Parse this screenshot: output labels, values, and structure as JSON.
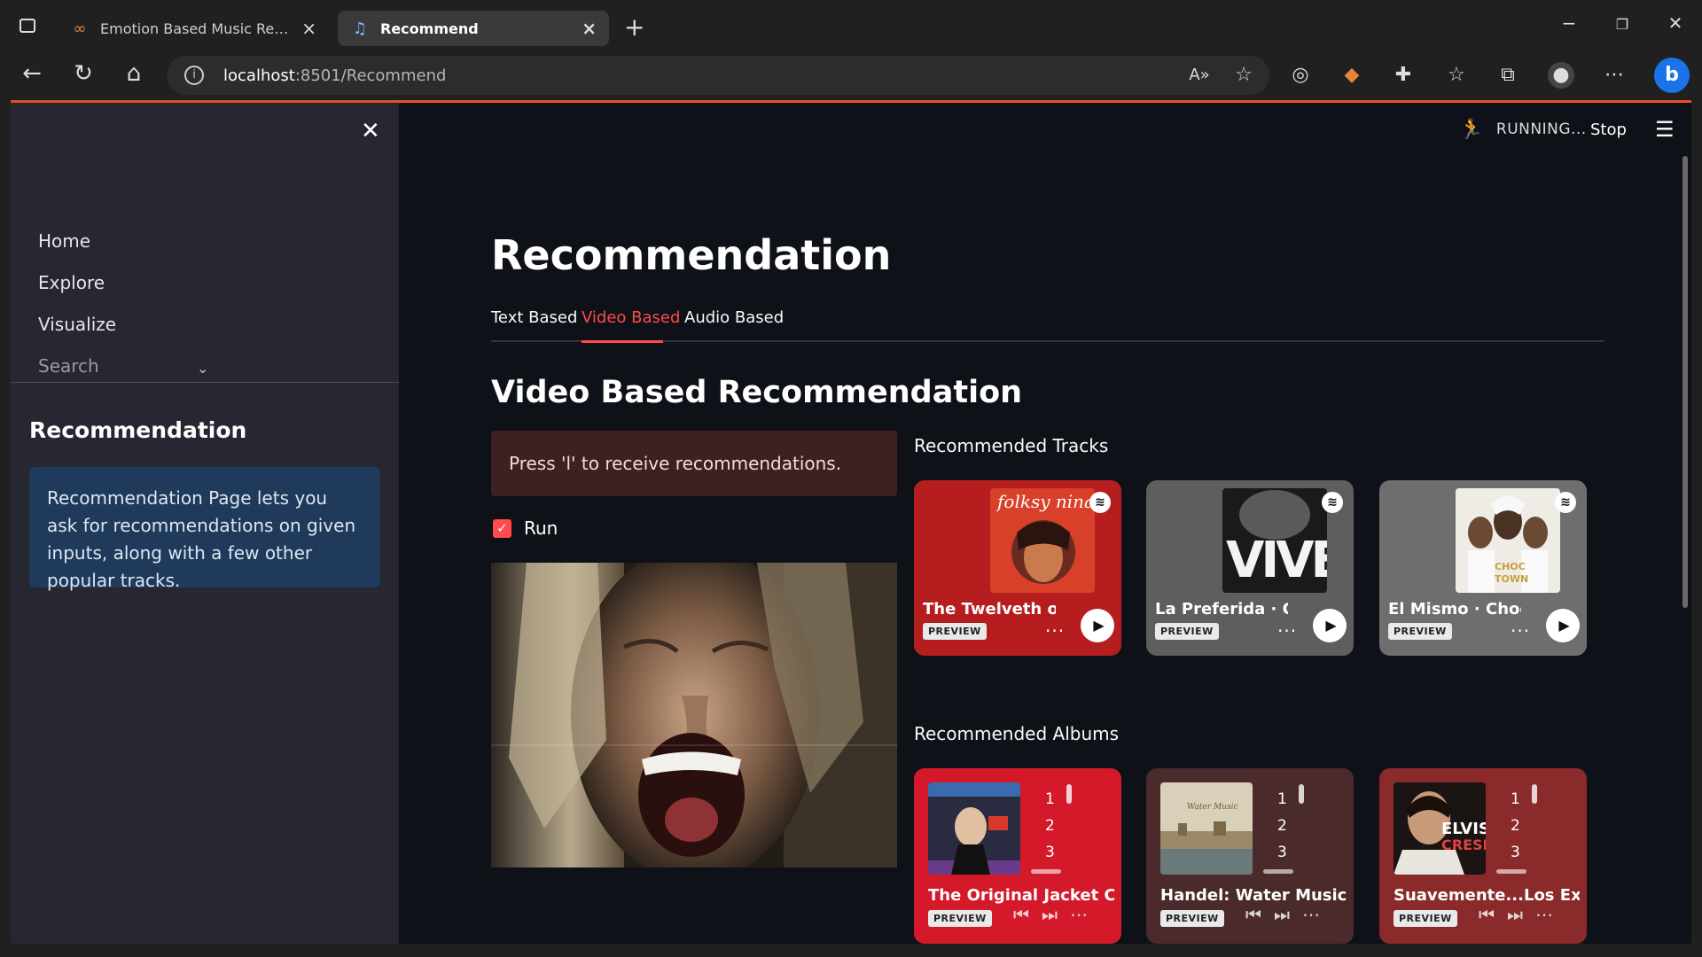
{
  "browser": {
    "tabs": [
      {
        "title": "Emotion Based Music Recommer",
        "icon": "streamlit-icon",
        "active": false
      },
      {
        "title": "Recommend",
        "icon": "music-notes-icon",
        "active": true
      }
    ],
    "url_host": "localhost",
    "url_path": ":8501/Recommend"
  },
  "sidebar": {
    "nav": [
      "Home",
      "Explore",
      "Visualize",
      "Search"
    ],
    "title": "Recommendation",
    "info": "Recommendation Page lets you ask for recommendations on given inputs, along with a few other popular tracks."
  },
  "header": {
    "status": "RUNNING...",
    "stop": "Stop"
  },
  "main": {
    "title": "Recommendation",
    "tabs": [
      "Text Based",
      "Video Based",
      "Audio Based"
    ],
    "active_tab": "Video Based",
    "section_title": "Video Based Recommendation",
    "warning": "Press 'l' to receive recommendations.",
    "checkbox_label": "Run",
    "checkbox_checked": true
  },
  "tracks": {
    "label": "Recommended Tracks",
    "items": [
      {
        "title": "The Twelveth of N",
        "preview": "PREVIEW",
        "color": "#b61d1f"
      },
      {
        "title": "La Preferida · Carl",
        "preview": "PREVIEW",
        "color": "#5e5e5e"
      },
      {
        "title": "El Mismo · ChocQ",
        "preview": "PREVIEW",
        "color": "#6e6e6e"
      }
    ]
  },
  "albums": {
    "label": "Recommended Albums",
    "items": [
      {
        "title": "The Original Jacket Colle",
        "preview": "PREVIEW",
        "color": "#d41a2a"
      },
      {
        "title": "Handel: Water Music · G",
        "preview": "PREVIEW",
        "color": "#4a2a2a"
      },
      {
        "title": "Suavemente...Los Exitos",
        "preview": "PREVIEW",
        "color": "#8a2a2a"
      }
    ]
  },
  "colors": {
    "accent": "#ff4b4b",
    "background": "#0e1117",
    "sidebar": "#262730"
  }
}
